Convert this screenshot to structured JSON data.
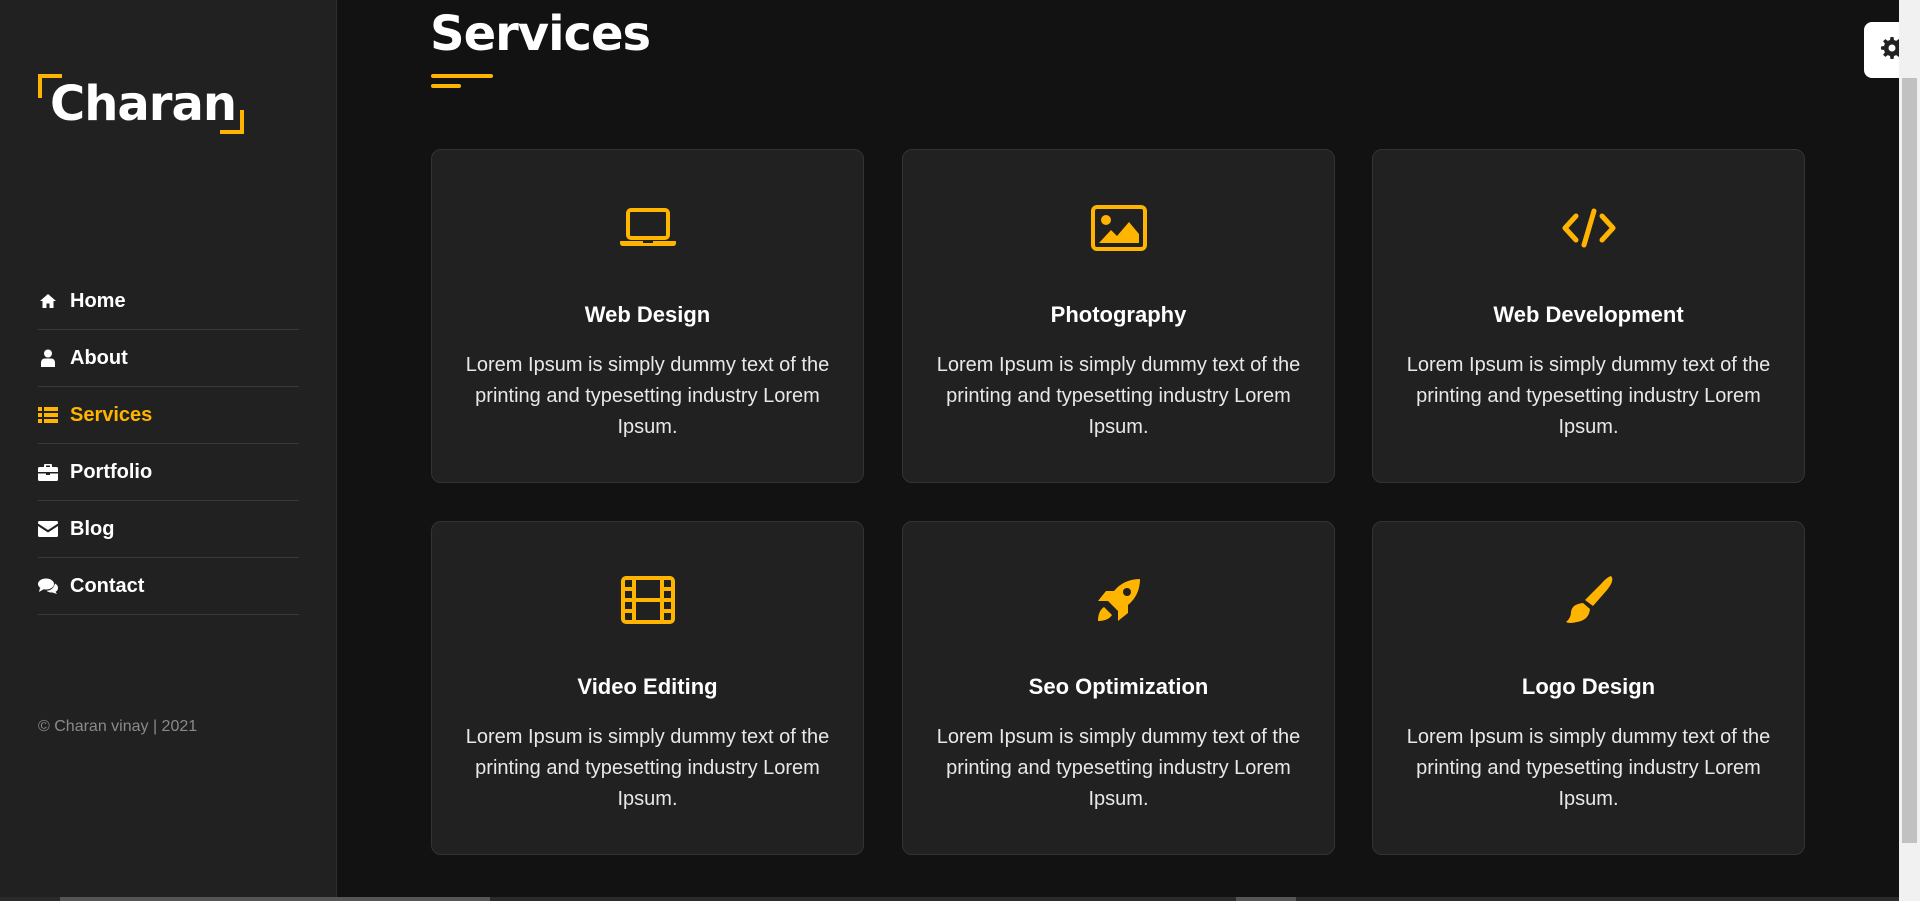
{
  "brand": {
    "logo_text": "Charan"
  },
  "nav": {
    "items": [
      {
        "label": "Home",
        "icon": "home-icon"
      },
      {
        "label": "About",
        "icon": "user-icon"
      },
      {
        "label": "Services",
        "icon": "list-icon",
        "active": true
      },
      {
        "label": "Portfolio",
        "icon": "briefcase-icon"
      },
      {
        "label": "Blog",
        "icon": "envelope-icon"
      },
      {
        "label": "Contact",
        "icon": "comments-icon"
      }
    ]
  },
  "footer": {
    "copyright": "© Charan vinay | 2021"
  },
  "main": {
    "title": "Services",
    "services": [
      {
        "title": "Web Design",
        "text": "Lorem Ipsum is simply dummy text of the printing and typesetting industry Lorem Ipsum.",
        "icon": "laptop-icon"
      },
      {
        "title": "Photography",
        "text": "Lorem Ipsum is simply dummy text of the printing and typesetting industry Lorem Ipsum.",
        "icon": "image-icon"
      },
      {
        "title": "Web Development",
        "text": "Lorem Ipsum is simply dummy text of the printing and typesetting industry Lorem Ipsum.",
        "icon": "code-icon"
      },
      {
        "title": "Video Editing",
        "text": "Lorem Ipsum is simply dummy text of the printing and typesetting industry Lorem Ipsum.",
        "icon": "film-icon"
      },
      {
        "title": "Seo Optimization",
        "text": "Lorem Ipsum is simply dummy text of the printing and typesetting industry Lorem Ipsum.",
        "icon": "rocket-icon"
      },
      {
        "title": "Logo Design",
        "text": "Lorem Ipsum is simply dummy text of the printing and typesetting industry Lorem Ipsum.",
        "icon": "paint-brush-icon"
      }
    ]
  },
  "colors": {
    "accent": "#ffb400",
    "sidebar_bg": "#212121",
    "page_bg": "#121212",
    "card_bg": "#212121"
  },
  "settings": {
    "icon": "gear-icon"
  }
}
